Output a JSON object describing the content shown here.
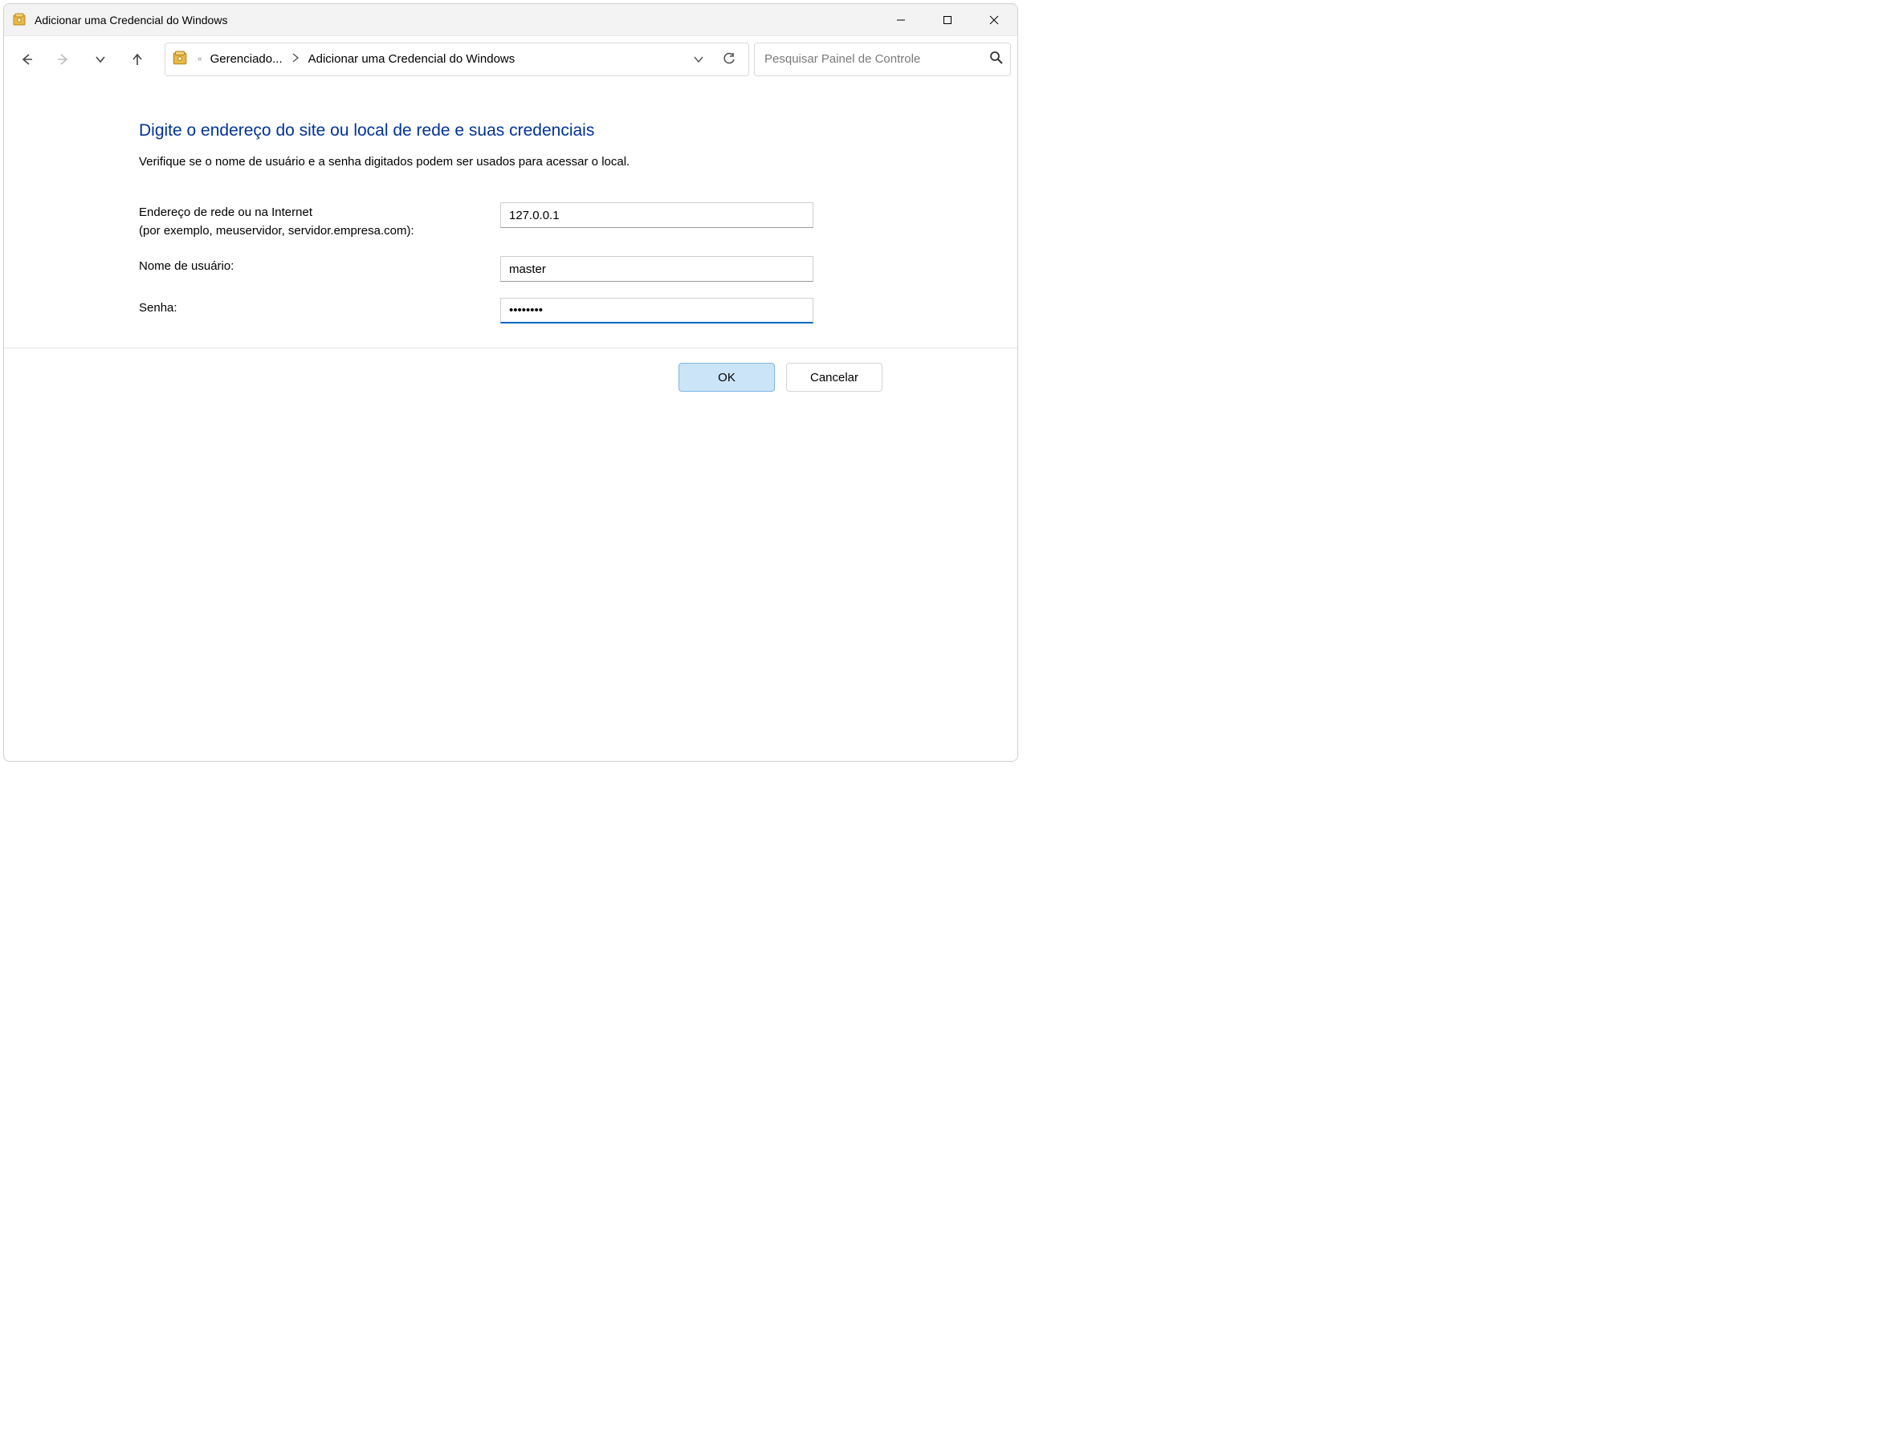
{
  "window": {
    "title": "Adicionar uma Credencial do Windows"
  },
  "toolbar": {
    "breadcrumb": {
      "parent": "Gerenciado...",
      "current": "Adicionar uma Credencial do Windows"
    },
    "search_placeholder": "Pesquisar Painel de Controle"
  },
  "content": {
    "heading": "Digite o endereço do site ou local de rede e suas credenciais",
    "subtext": "Verifique se o nome de usuário e a senha digitados podem ser usados para acessar o local.",
    "address_label_line1": "Endereço de rede ou na Internet",
    "address_label_line2": "(por exemplo, meuservidor, servidor.empresa.com):",
    "address_value": "127.0.0.1",
    "username_label": "Nome de usuário:",
    "username_value": "master",
    "password_label": "Senha:",
    "password_value": "••••••••"
  },
  "buttons": {
    "ok": "OK",
    "cancel": "Cancelar"
  }
}
